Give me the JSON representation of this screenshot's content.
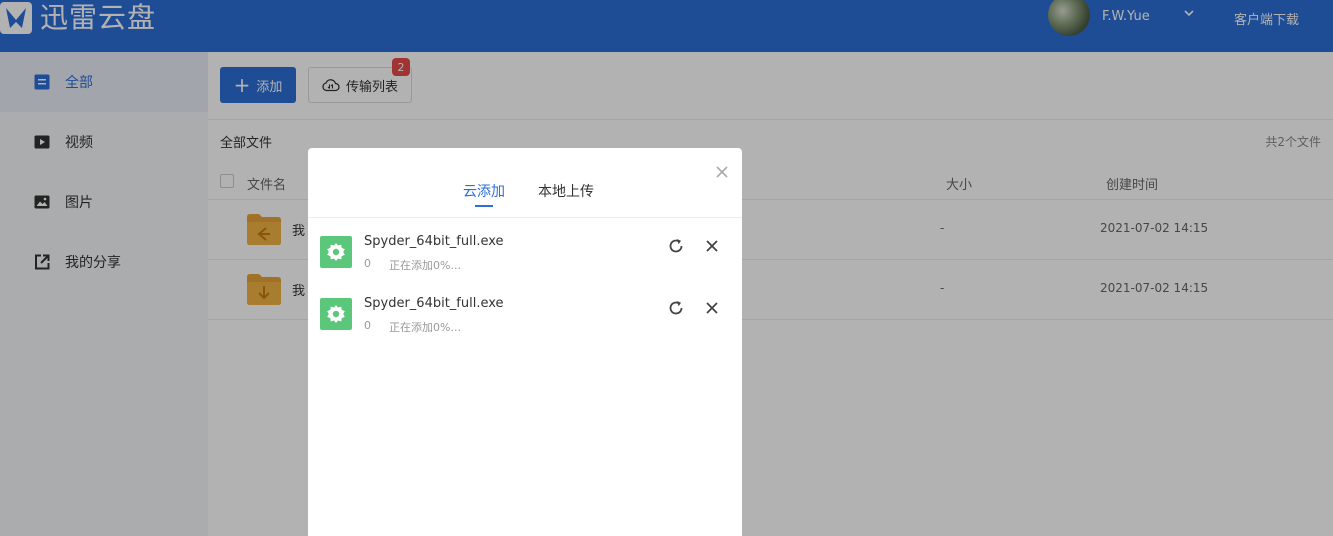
{
  "header": {
    "logo_text": "迅雷云盘",
    "username": "F.W.Yue",
    "client_download": "客户端下载"
  },
  "sidebar": {
    "items": [
      {
        "label": "全部",
        "icon": "list-icon",
        "active": true
      },
      {
        "label": "视频",
        "icon": "video-icon",
        "active": false
      },
      {
        "label": "图片",
        "icon": "image-icon",
        "active": false
      },
      {
        "label": "我的分享",
        "icon": "share-icon",
        "active": false
      }
    ]
  },
  "toolbar": {
    "add_label": "添加",
    "transfer_label": "传输列表",
    "transfer_badge": "2"
  },
  "files": {
    "title": "全部文件",
    "count_text": "共2个文件",
    "columns": {
      "name": "文件名",
      "size": "大小",
      "created": "创建时间"
    },
    "rows": [
      {
        "name": "我",
        "size": "-",
        "created": "2021-07-02 14:15"
      },
      {
        "name": "我",
        "size": "-",
        "created": "2021-07-02 14:15"
      }
    ]
  },
  "dialog": {
    "tabs": [
      {
        "label": "云添加",
        "active": true
      },
      {
        "label": "本地上传",
        "active": false
      }
    ],
    "tasks": [
      {
        "name": "Spyder_64bit_full.exe",
        "size": "0",
        "status": "正在添加0%..."
      },
      {
        "name": "Spyder_64bit_full.exe",
        "size": "0",
        "status": "正在添加0%..."
      }
    ]
  },
  "colors": {
    "brand": "#2c6fd6",
    "badge": "#e84a4a",
    "task_icon": "#5bc77a",
    "folder": "#e8a23a"
  }
}
